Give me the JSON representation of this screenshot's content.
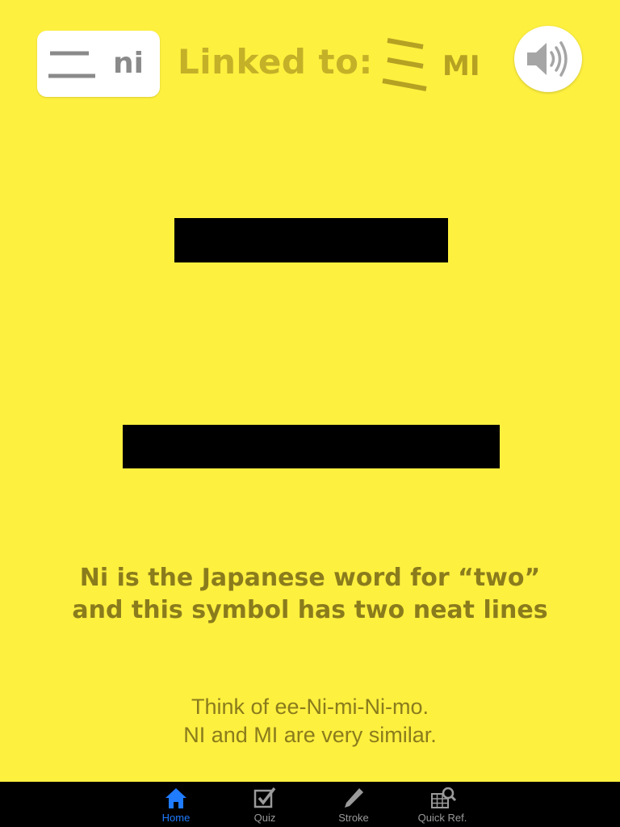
{
  "header": {
    "current_kana_romaji": "ni",
    "linked_label": "Linked to:",
    "linked_kana_romaji": "MI"
  },
  "icons": {
    "current_kana": "ni-kana-glyph",
    "linked_kana": "mi-kana-glyph",
    "sound": "speaker-icon"
  },
  "content": {
    "mnemonic": "Ni is the Japanese word for “two” and this symbol has two neat lines",
    "hint_line1": "Think of ee-Ni-mi-Ni-mo.",
    "hint_line2": "NI and MI are very similar."
  },
  "tabs": [
    {
      "label": "Home",
      "icon": "home-icon",
      "active": true
    },
    {
      "label": "Quiz",
      "icon": "checkbox-icon",
      "active": false
    },
    {
      "label": "Stroke",
      "icon": "pencil-icon",
      "active": false
    },
    {
      "label": "Quick Ref.",
      "icon": "grid-search-icon",
      "active": false
    }
  ],
  "colors": {
    "background": "#fef03f",
    "text": "#8a7c1c",
    "accent_label": "#c4b128",
    "tab_active": "#1f7bff",
    "tab_inactive": "#9a9a9a"
  }
}
